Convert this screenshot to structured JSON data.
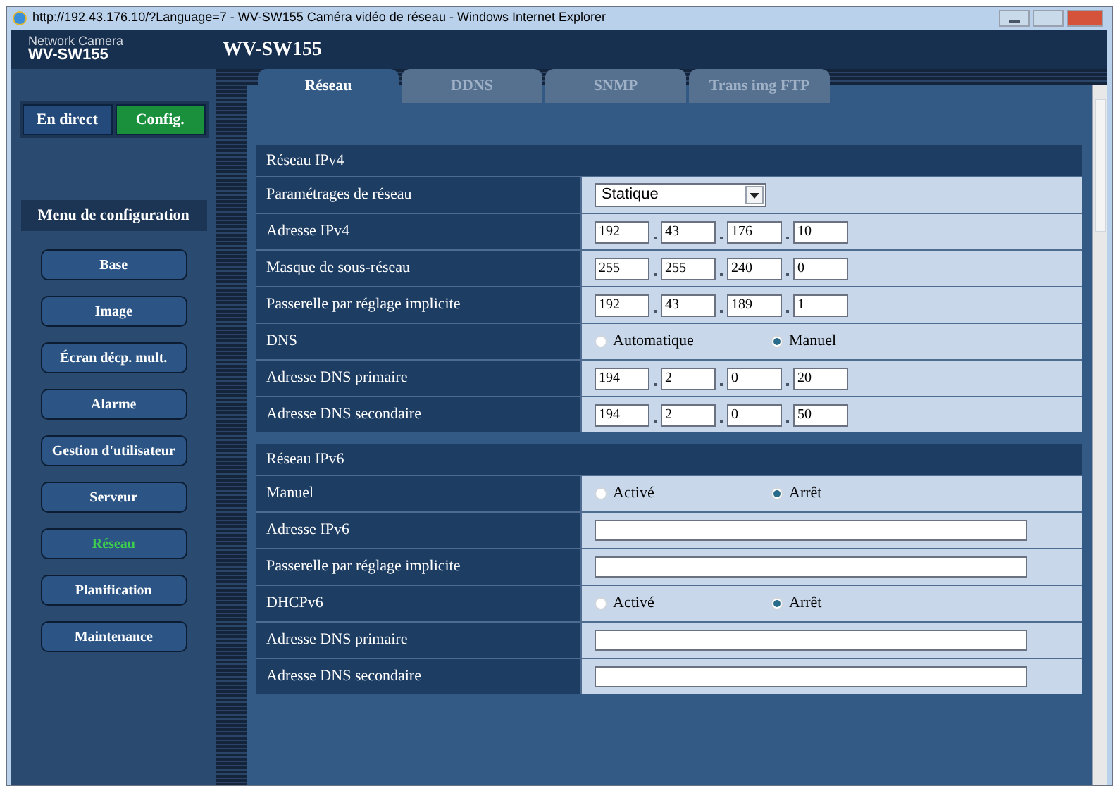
{
  "window": {
    "title": "http://192.43.176.10/?Language=7 - WV-SW155 Caméra vidéo de réseau - Windows Internet Explorer"
  },
  "header": {
    "brand_top": "Network Camera",
    "brand_model": "WV-SW155",
    "title": "WV-SW155"
  },
  "mode_buttons": [
    {
      "label": "En direct",
      "selected": false
    },
    {
      "label": "Config.",
      "selected": true
    }
  ],
  "menu": {
    "title": "Menu de configuration",
    "items": [
      {
        "label": "Base",
        "selected": false
      },
      {
        "label": "Image",
        "selected": false
      },
      {
        "label": "Écran décp. mult.",
        "selected": false
      },
      {
        "label": "Alarme",
        "selected": false
      },
      {
        "label": "Gestion d'utilisateur",
        "selected": false
      },
      {
        "label": "Serveur",
        "selected": false
      },
      {
        "label": "Réseau",
        "selected": true
      },
      {
        "label": "Planification",
        "selected": false
      },
      {
        "label": "Maintenance",
        "selected": false
      }
    ]
  },
  "tabs": [
    {
      "label": "Réseau",
      "selected": true
    },
    {
      "label": "DDNS",
      "selected": false
    },
    {
      "label": "SNMP",
      "selected": false
    },
    {
      "label": "Trans img FTP",
      "selected": false
    }
  ],
  "sections": [
    {
      "title": "Réseau IPv4",
      "rows": [
        {
          "kind": "select",
          "label": "Paramétrages de réseau",
          "value": "Statique"
        },
        {
          "kind": "ip",
          "label": "Adresse IPv4",
          "values": [
            "192",
            "43",
            "176",
            "10"
          ]
        },
        {
          "kind": "ip",
          "label": "Masque de sous-réseau",
          "values": [
            "255",
            "255",
            "240",
            "0"
          ]
        },
        {
          "kind": "ip",
          "label": "Passerelle par réglage implicite",
          "values": [
            "192",
            "43",
            "189",
            "1"
          ]
        },
        {
          "kind": "radio",
          "label": "DNS",
          "options": [
            {
              "label": "Automatique",
              "selected": false
            },
            {
              "label": "Manuel",
              "selected": true
            }
          ]
        },
        {
          "kind": "ip",
          "label": "Adresse DNS primaire",
          "values": [
            "194",
            "2",
            "0",
            "20"
          ]
        },
        {
          "kind": "ip",
          "label": "Adresse DNS secondaire",
          "values": [
            "194",
            "2",
            "0",
            "50"
          ]
        }
      ]
    },
    {
      "title": "Réseau IPv6",
      "rows": [
        {
          "kind": "radio",
          "label": "Manuel",
          "options": [
            {
              "label": "Activé",
              "selected": false
            },
            {
              "label": "Arrêt",
              "selected": true
            }
          ]
        },
        {
          "kind": "text",
          "label": "Adresse IPv6"
        },
        {
          "kind": "text",
          "label": "Passerelle par réglage implicite"
        },
        {
          "kind": "radio",
          "label": "DHCPv6",
          "options": [
            {
              "label": "Activé",
              "selected": false
            },
            {
              "label": "Arrêt",
              "selected": true
            }
          ]
        },
        {
          "kind": "text",
          "label": "Adresse DNS primaire"
        },
        {
          "kind": "text",
          "label": "Adresse DNS secondaire"
        }
      ]
    }
  ]
}
